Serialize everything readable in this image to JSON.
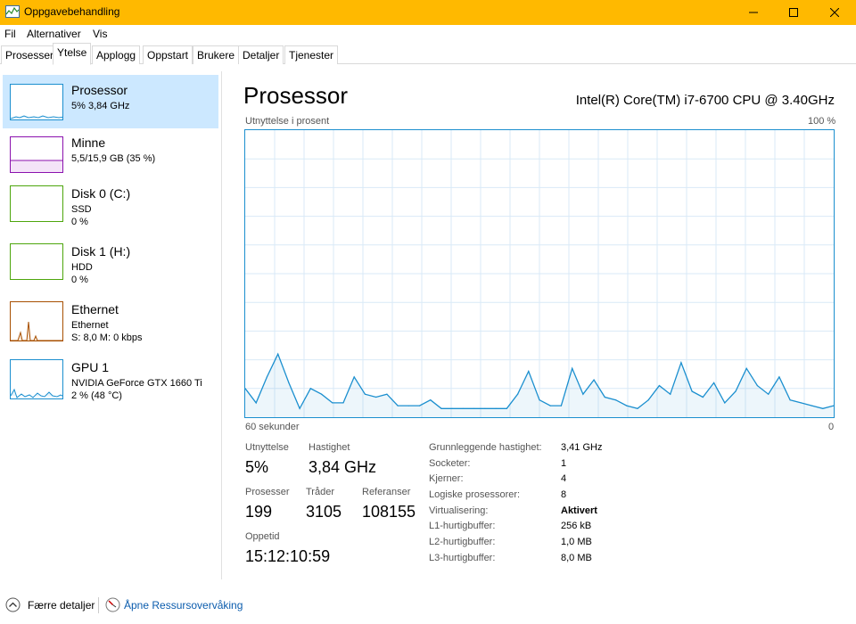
{
  "window": {
    "title": "Oppgavebehandling"
  },
  "menu": [
    "Fil",
    "Alternativer",
    "Vis"
  ],
  "tabs": [
    "Prosesser",
    "Ytelse",
    "Applogg",
    "Oppstart",
    "Brukere",
    "Detaljer",
    "Tjenester"
  ],
  "sidebar": [
    {
      "title": "Prosessor",
      "line1": "5% 3,84 GHz",
      "line2": ""
    },
    {
      "title": "Minne",
      "line1": "5,5/15,9 GB (35 %)",
      "line2": ""
    },
    {
      "title": "Disk 0 (C:)",
      "line1": "SSD",
      "line2": "0 %"
    },
    {
      "title": "Disk 1 (H:)",
      "line1": "HDD",
      "line2": "0 %"
    },
    {
      "title": "Ethernet",
      "line1": "Ethernet",
      "line2": "S: 8,0  M: 0 kbps"
    },
    {
      "title": "GPU 1",
      "line1": "NVIDIA GeForce GTX 1660 Ti",
      "line2": "2 % (48 °C)"
    }
  ],
  "main": {
    "title": "Prosessor",
    "cpu_name": "Intel(R) Core(TM) i7-6700 CPU @ 3.40GHz",
    "graph_label": "Utnyttelse i prosent",
    "graph_max": "100 %",
    "graph_time": "60 sekunder",
    "graph_min": "0"
  },
  "stats": {
    "utilization_label": "Utnyttelse",
    "utilization": "5%",
    "speed_label": "Hastighet",
    "speed": "3,84 GHz",
    "processes_label": "Prosesser",
    "processes": "199",
    "threads_label": "Tråder",
    "threads": "3105",
    "handles_label": "Referanser",
    "handles": "108155",
    "uptime_label": "Oppetid",
    "uptime": "15:12:10:59"
  },
  "details": [
    {
      "label": "Grunnleggende hastighet:",
      "value": "3,41 GHz",
      "bold": false
    },
    {
      "label": "Socketer:",
      "value": "1",
      "bold": false
    },
    {
      "label": "Kjerner:",
      "value": "4",
      "bold": false
    },
    {
      "label": "Logiske prosessorer:",
      "value": "8",
      "bold": false
    },
    {
      "label": "Virtualisering:",
      "value": "Aktivert",
      "bold": true
    },
    {
      "label": "L1-hurtigbuffer:",
      "value": "256 kB",
      "bold": false
    },
    {
      "label": "L2-hurtigbuffer:",
      "value": "1,0 MB",
      "bold": false
    },
    {
      "label": "L3-hurtigbuffer:",
      "value": "8,0 MB",
      "bold": false
    }
  ],
  "footer": {
    "fewer_details": "Færre detaljer",
    "resource_monitor": "Åpne Ressursovervåking"
  },
  "chart_data": {
    "type": "area",
    "ylim": [
      0,
      100
    ],
    "values": [
      10,
      5,
      14,
      22,
      12,
      3,
      10,
      8,
      5,
      5,
      14,
      8,
      7,
      8,
      4,
      4,
      4,
      6,
      3,
      3,
      3,
      3,
      3,
      3,
      3,
      8,
      16,
      6,
      4,
      4,
      17,
      8,
      13,
      7,
      6,
      4,
      3,
      6,
      11,
      8,
      19,
      9,
      7,
      12,
      5,
      9,
      17,
      11,
      8,
      14,
      6,
      5,
      4,
      3,
      4
    ]
  },
  "colors": {
    "accent": "#ffb900",
    "cpu": "#1b8fcf",
    "memory": "#8b12ae",
    "disk": "#4da60c",
    "ethernet": "#a74f01",
    "gpu": "#1b8fcf",
    "selected": "#cce8ff"
  }
}
